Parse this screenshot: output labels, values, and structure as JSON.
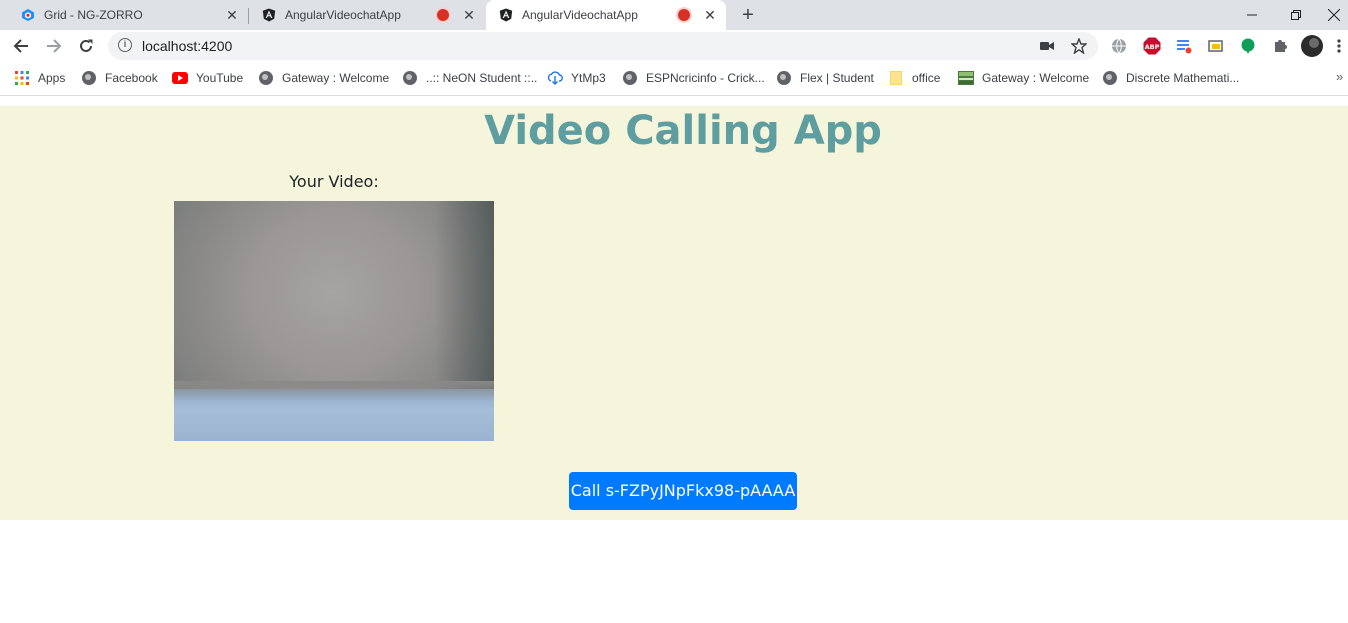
{
  "browser": {
    "tabs": [
      {
        "title": "Grid - NG-ZORRO",
        "icon": "ng-zorro-icon",
        "active": false,
        "recording": false
      },
      {
        "title": "AngularVideochatApp",
        "icon": "angular-icon",
        "active": false,
        "recording": true
      },
      {
        "title": "AngularVideochatApp",
        "icon": "angular-icon",
        "active": true,
        "recording": true
      }
    ],
    "address": "localhost:4200",
    "bookmarks": [
      {
        "label": "Apps",
        "icon": "apps-grid-icon"
      },
      {
        "label": "Facebook",
        "icon": "globe-icon"
      },
      {
        "label": "YouTube",
        "icon": "youtube-icon"
      },
      {
        "label": "Gateway : Welcome",
        "icon": "globe-icon"
      },
      {
        "label": "..:: NeON Student ::..",
        "icon": "globe-icon"
      },
      {
        "label": "YtMp3",
        "icon": "download-cloud-icon"
      },
      {
        "label": "ESPNcricinfo - Crick...",
        "icon": "globe-icon"
      },
      {
        "label": "Flex | Student",
        "icon": "globe-icon"
      },
      {
        "label": "office",
        "icon": "folder-icon"
      },
      {
        "label": "Gateway : Welcome",
        "icon": "image-icon"
      },
      {
        "label": "Discrete Mathemati...",
        "icon": "globe-icon"
      }
    ],
    "more_bookmarks": "»"
  },
  "app": {
    "title": "Video Calling App",
    "your_video_label": "Your Video:",
    "call_button_label": "Call s-FZPyJNpFkx98-pAAAA"
  },
  "colors": {
    "app_background": "#f5f5dc",
    "title_color": "#5f9ea0",
    "call_button": "#007bff"
  }
}
